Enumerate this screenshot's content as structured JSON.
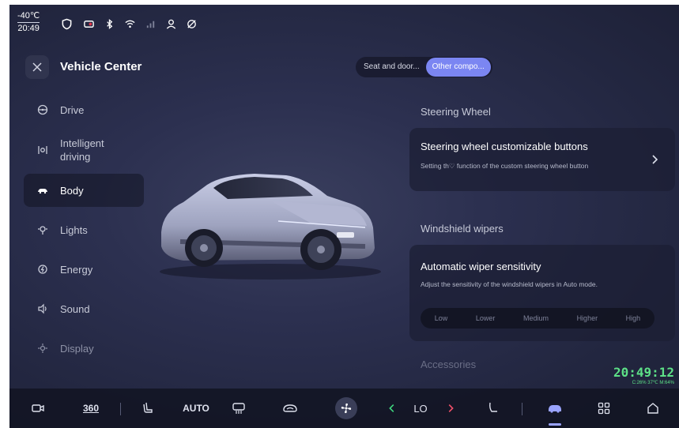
{
  "status": {
    "temperature": "-40℃",
    "clock": "20:49"
  },
  "header": {
    "title": "Vehicle Center",
    "tabs": [
      {
        "label": "Seat and door..."
      },
      {
        "label": "Other compo..."
      }
    ]
  },
  "sidebar": {
    "items": [
      {
        "label": "Drive",
        "icon": "steering-wheel-icon"
      },
      {
        "label": "Intelligent driving",
        "icon": "intelligent-driving-icon"
      },
      {
        "label": "Body",
        "icon": "car-body-icon"
      },
      {
        "label": "Lights",
        "icon": "light-icon"
      },
      {
        "label": "Energy",
        "icon": "energy-icon"
      },
      {
        "label": "Sound",
        "icon": "speaker-icon"
      },
      {
        "label": "Display",
        "icon": "display-icon"
      }
    ]
  },
  "steering": {
    "section": "Steering Wheel",
    "card_title": "Steering wheel customizable buttons",
    "card_desc": "Setting th♡ function of the custom steering wheel button"
  },
  "wipers": {
    "section": "Windshield wipers",
    "card_title": "Automatic wiper sensitivity",
    "card_desc": "Adjust the sensitivity of the windshield wipers in Auto mode.",
    "options": [
      "Low",
      "Lower",
      "Medium",
      "Higher",
      "High"
    ]
  },
  "accessories": {
    "section": "Accessories"
  },
  "overlay_clock": {
    "time": "20:49:12",
    "info": "C:26% 37℃ M:64%"
  },
  "bottom": {
    "view360": "360",
    "auto": "AUTO",
    "fan_level": "LO"
  },
  "colors": {
    "accent": "#7b86f2",
    "clock": "#5de087",
    "background": "#262a45"
  }
}
